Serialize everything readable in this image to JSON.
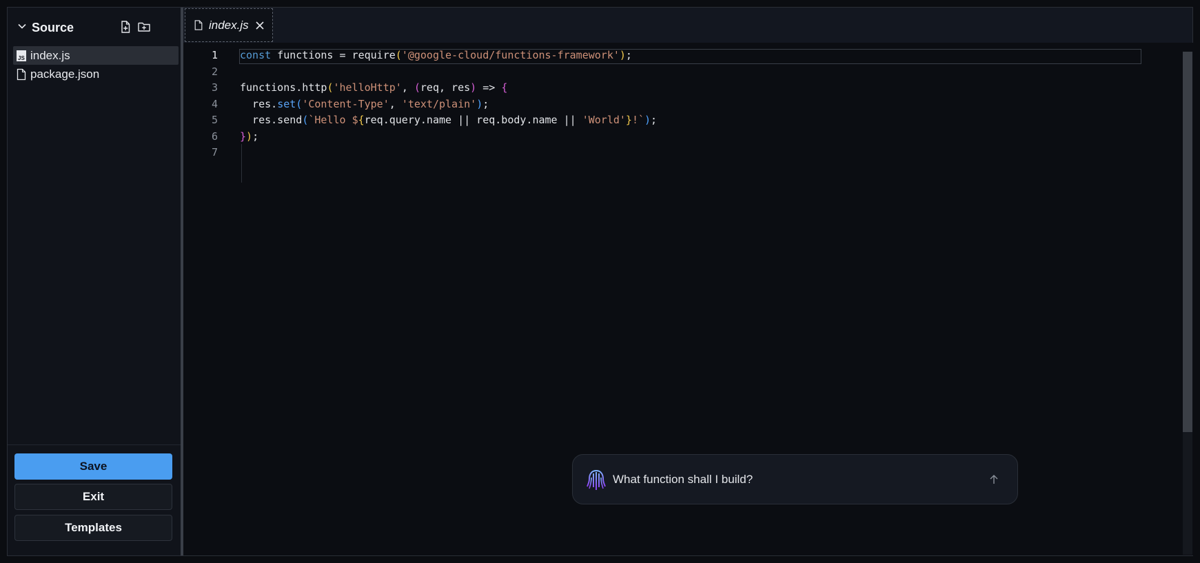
{
  "sidebar": {
    "title": "Source",
    "files": [
      {
        "name": "index.js",
        "icon": "js-file-icon",
        "active": true
      },
      {
        "name": "package.json",
        "icon": "file-icon",
        "active": false
      }
    ],
    "buttons": {
      "save": "Save",
      "exit": "Exit",
      "templates": "Templates"
    }
  },
  "tabs": [
    {
      "label": "index.js"
    }
  ],
  "editor": {
    "line_numbers": [
      "1",
      "2",
      "3",
      "4",
      "5",
      "6",
      "7"
    ],
    "current_line": 1,
    "code_lines": [
      "const functions = require('@google-cloud/functions-framework');",
      "",
      "functions.http('helloHttp', (req, res) => {",
      "  res.set('Content-Type', 'text/plain');",
      "  res.send(`Hello ${req.query.name || req.body.name || 'World'}!`);",
      "});",
      ""
    ]
  },
  "prompt": {
    "placeholder": "What function shall I build?"
  },
  "colors": {
    "primary_button": "#4a9df0",
    "keyword": "#569cd6",
    "string": "#ce9178",
    "bracket_1": "#f2c94c",
    "bracket_2": "#d65fd6",
    "bracket_3": "#4fa3ff"
  }
}
